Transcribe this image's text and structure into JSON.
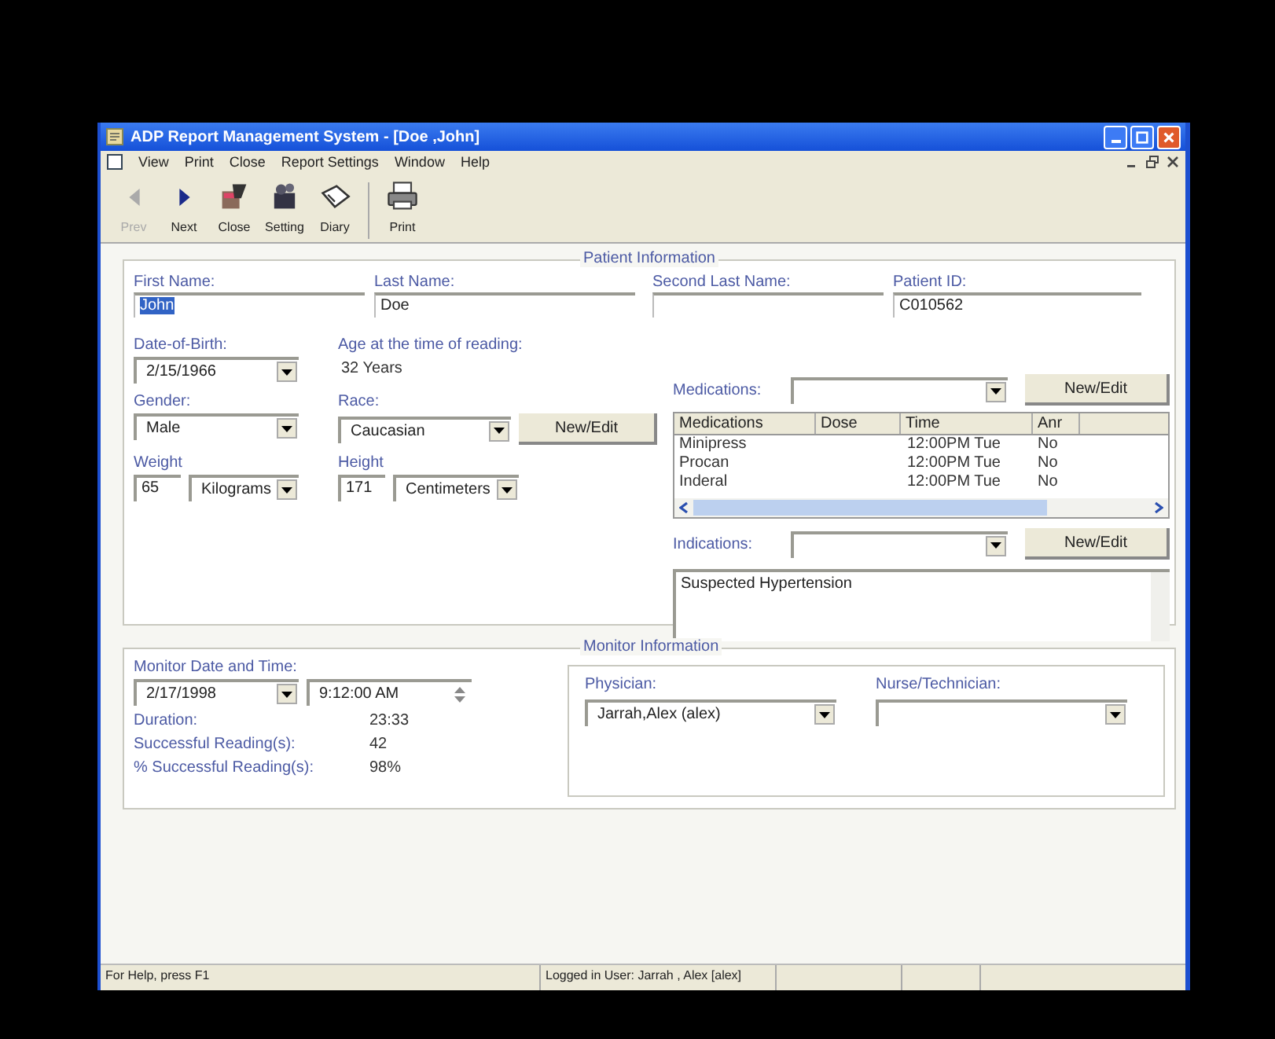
{
  "window": {
    "title": "ADP Report Management System - [Doe ,John]"
  },
  "menu": [
    "View",
    "Print",
    "Close",
    "Report Settings",
    "Window",
    "Help"
  ],
  "toolbar": [
    {
      "label": "Prev",
      "kind": "prev",
      "disabled": true
    },
    {
      "label": "Next",
      "kind": "next",
      "disabled": false
    },
    {
      "label": "Close",
      "kind": "close",
      "disabled": false
    },
    {
      "label": "Setting",
      "kind": "setting",
      "disabled": false
    },
    {
      "label": "Diary",
      "kind": "diary",
      "disabled": false
    },
    {
      "label": "Print",
      "kind": "print",
      "disabled": false
    }
  ],
  "patient_info": {
    "title": "Patient Information",
    "names": [
      {
        "label": "First Name:",
        "value": "John",
        "highlighted": true
      },
      {
        "label": "Last Name:",
        "value": "Doe",
        "highlighted": false
      },
      {
        "label": "Second Last Name:"
      },
      {
        "label": "Patient ID:",
        "value": "C010562",
        "highlighted": false
      }
    ],
    "dob": {
      "label": "Date-of-Birth:",
      "value": "2/15/1966"
    },
    "age": {
      "label": "Age at the time of reading:",
      "value": "32 Years"
    },
    "gender": {
      "label": "Gender:",
      "value": "Male"
    },
    "race": {
      "label": "Race:",
      "value": "Caucasian",
      "button": "New/Edit"
    },
    "weight": {
      "label": "Weight",
      "value": "65",
      "unit": "Kilograms"
    },
    "height": {
      "label": "Height",
      "value": "171",
      "unit": "Centimeters"
    },
    "medications": {
      "label": "Medications:",
      "button": "New/Edit",
      "columns": [
        "Medications",
        "Dose",
        "Time",
        "Anr"
      ],
      "rows": [
        [
          "Minipress",
          "",
          "12:00PM Tue",
          "No"
        ],
        [
          "Procan",
          "",
          "12:00PM Tue",
          "No"
        ],
        [
          "Inderal",
          "",
          "12:00PM Tue",
          "No"
        ]
      ]
    },
    "indications": {
      "label": "Indications:",
      "button": "New/Edit",
      "text": "Suspected Hypertension"
    }
  },
  "monitor_info": {
    "title": "Monitor Information",
    "datetime": {
      "label": "Monitor Date and Time:",
      "date": "2/17/1998",
      "time": "9:12:00 AM"
    },
    "stats": [
      {
        "label": "Duration:",
        "value": "23:33"
      },
      {
        "label": "Successful Reading(s):",
        "value": "42"
      },
      {
        "label": "% Successful Reading(s):",
        "value": "98%"
      }
    ],
    "physician": {
      "label": "Physician:",
      "value": "Jarrah,Alex (alex)"
    },
    "nurse": {
      "label": "Nurse/Technician:"
    }
  },
  "status_bar": [
    "For Help, press F1",
    "Logged in User: Jarrah , Alex [alex]"
  ]
}
